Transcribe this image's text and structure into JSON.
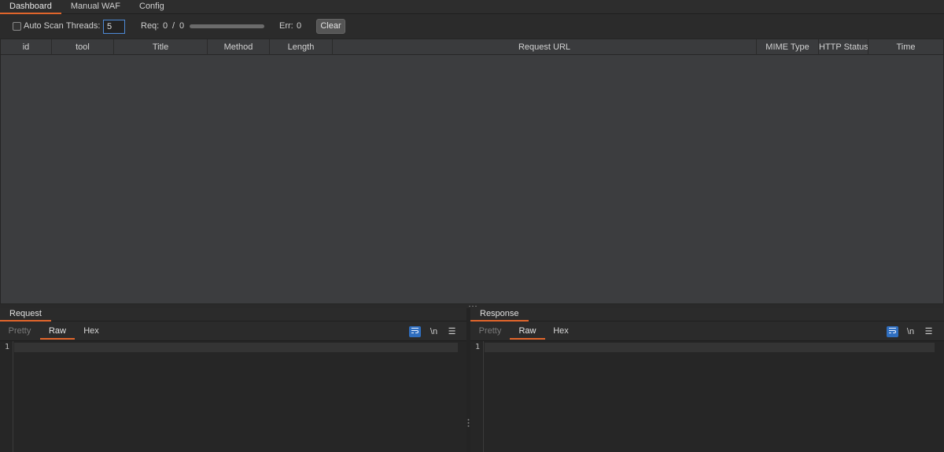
{
  "top_tabs": [
    {
      "label": "Dashboard",
      "active": true
    },
    {
      "label": "Manual WAF",
      "active": false
    },
    {
      "label": "Config",
      "active": false
    }
  ],
  "toolbar": {
    "auto_scan_label": "Auto Scan",
    "auto_scan_checked": false,
    "threads_label": "Threads:",
    "threads_value": "5",
    "req_label": "Req:",
    "req_done": "0",
    "req_sep": "/",
    "req_total": "0",
    "req_progress": 0,
    "err_label": "Err:",
    "err_value": "0",
    "clear_label": "Clear"
  },
  "table": {
    "columns": [
      "id",
      "tool",
      "Title",
      "Method",
      "Length",
      "Request URL",
      "MIME Type",
      "HTTP Status",
      "Time"
    ],
    "rows": []
  },
  "request_pane": {
    "title": "Request",
    "tabs": [
      "Pretty",
      "Raw",
      "Hex"
    ],
    "active_tab": "Raw",
    "wrap_icon": "wrap-lines-icon",
    "newline_label": "\\n",
    "menu_icon": "menu-icon",
    "line_number": "1"
  },
  "response_pane": {
    "title": "Response",
    "tabs": [
      "Pretty",
      "Raw",
      "Hex"
    ],
    "active_tab": "Raw",
    "wrap_icon": "wrap-lines-icon",
    "newline_label": "\\n",
    "menu_icon": "menu-icon",
    "line_number": "1"
  },
  "colors": {
    "accent": "#e0652b",
    "selection_blue": "#2f6ebf",
    "background": "#2b2b2b",
    "table_bg": "#3c3d3f"
  }
}
